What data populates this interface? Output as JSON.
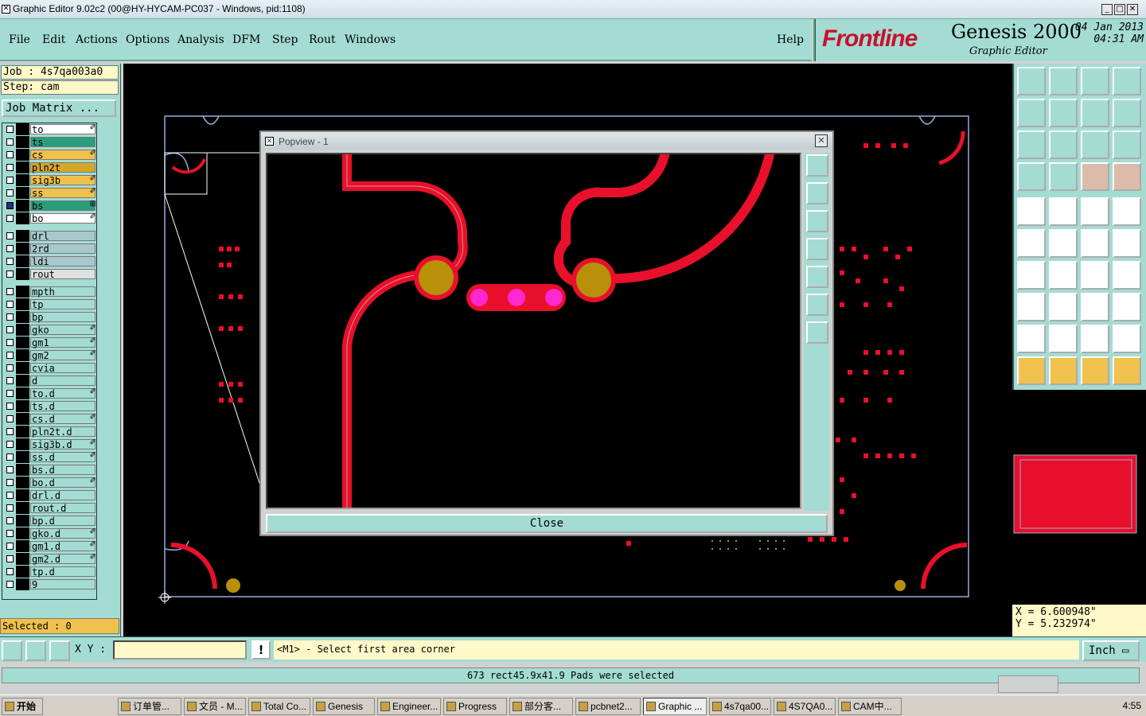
{
  "window": {
    "title": "Graphic Editor 9.02c2 (00@HY-HYCAM-PC037 - Windows, pid:1108)",
    "min": "_",
    "max": "□",
    "close": "✕"
  },
  "menu": {
    "file": "File",
    "edit": "Edit",
    "actions": "Actions",
    "options": "Options",
    "analysis": "Analysis",
    "dfm": "DFM",
    "step": "Step",
    "rout": "Rout",
    "windows": "Windows",
    "help": "Help"
  },
  "brand": {
    "logo": "Frontline",
    "product": "Genesis 2000",
    "subtitle": "Graphic Editor",
    "date": "04 Jan 2013",
    "time": "04:31 AM"
  },
  "job": {
    "job_line": "Job : 4s7qa003a0",
    "step_line": "Step: cam",
    "matrix_button": "Job Matrix ..."
  },
  "layers": [
    {
      "name": "to",
      "color": "#ffffff",
      "sw": "",
      "edit": "✐"
    },
    {
      "name": "ts",
      "color": "#2a9d7a",
      "sw": "",
      "edit": ""
    },
    {
      "name": "cs",
      "color": "#f0c14c",
      "sw": "",
      "edit": "✐"
    },
    {
      "name": "pln2t",
      "color": "#d4a72c",
      "sw": "",
      "edit": ""
    },
    {
      "name": "sig3b",
      "color": "#f0c14c",
      "sw": "",
      "edit": "✐"
    },
    {
      "name": "ss",
      "color": "#f0c14c",
      "sw": "",
      "edit": "✐"
    },
    {
      "name": "bs",
      "color": "#2a9d7a",
      "sw": "#e8102a",
      "edit": "⊞",
      "active": true
    },
    {
      "name": "bo",
      "color": "#ffffff",
      "sw": "",
      "edit": "✐"
    },
    {
      "name": "drl",
      "color": "#a8c8cc",
      "sw": "#3a9a2a",
      "edit": ""
    },
    {
      "name": "2rd",
      "color": "#a8c8cc",
      "sw": "#2040e0",
      "edit": ""
    },
    {
      "name": "ldi",
      "color": "#a8c8cc",
      "sw": "",
      "edit": ""
    },
    {
      "name": "rout",
      "color": "#e0e0e0",
      "sw": "",
      "edit": ""
    },
    {
      "name": "mpth",
      "color": "#a4dcd3",
      "sw": "",
      "edit": ""
    },
    {
      "name": "tp",
      "color": "#a4dcd3",
      "sw": "",
      "edit": ""
    },
    {
      "name": "bp",
      "color": "#a4dcd3",
      "sw": "",
      "edit": ""
    },
    {
      "name": "gko",
      "color": "#a4dcd3",
      "sw": "",
      "edit": "✐"
    },
    {
      "name": "gm1",
      "color": "#a4dcd3",
      "sw": "",
      "edit": "✐"
    },
    {
      "name": "gm2",
      "color": "#a4dcd3",
      "sw": "",
      "edit": "✐"
    },
    {
      "name": "cvia",
      "color": "#a4dcd3",
      "sw": "",
      "edit": ""
    },
    {
      "name": "d",
      "color": "#a4dcd3",
      "sw": "",
      "edit": ""
    },
    {
      "name": "to.d",
      "color": "#a4dcd3",
      "sw": "",
      "edit": "✐"
    },
    {
      "name": "ts.d",
      "color": "#a4dcd3",
      "sw": "",
      "edit": ""
    },
    {
      "name": "cs.d",
      "color": "#a4dcd3",
      "sw": "",
      "edit": "✐"
    },
    {
      "name": "pln2t.d",
      "color": "#a4dcd3",
      "sw": "",
      "edit": ""
    },
    {
      "name": "sig3b.d",
      "color": "#a4dcd3",
      "sw": "",
      "edit": "✐"
    },
    {
      "name": "ss.d",
      "color": "#a4dcd3",
      "sw": "",
      "edit": "✐"
    },
    {
      "name": "bs.d",
      "color": "#a4dcd3",
      "sw": "",
      "edit": ""
    },
    {
      "name": "bo.d",
      "color": "#a4dcd3",
      "sw": "",
      "edit": "✐"
    },
    {
      "name": "drl.d",
      "color": "#a4dcd3",
      "sw": "",
      "edit": ""
    },
    {
      "name": "rout.d",
      "color": "#a4dcd3",
      "sw": "",
      "edit": ""
    },
    {
      "name": "bp.d",
      "color": "#a4dcd3",
      "sw": "",
      "edit": ""
    },
    {
      "name": "gko.d",
      "color": "#a4dcd3",
      "sw": "",
      "edit": "✐"
    },
    {
      "name": "gm1.d",
      "color": "#a4dcd3",
      "sw": "",
      "edit": "✐"
    },
    {
      "name": "gm2.d",
      "color": "#a4dcd3",
      "sw": "",
      "edit": "✐"
    },
    {
      "name": "tp.d",
      "color": "#a4dcd3",
      "sw": "",
      "edit": ""
    },
    {
      "name": "9",
      "color": "#a4dcd3",
      "sw": "",
      "edit": ""
    }
  ],
  "selected": "Selected : 0",
  "popview": {
    "title": "Popview - 1",
    "close_label": "Close"
  },
  "coords": {
    "x": "X =  6.600948\"",
    "y": "Y =  5.232974\""
  },
  "cmd": {
    "xy_label": "X Y :",
    "xy_value": "",
    "warn": "!",
    "message": "<M1> - Select first area corner",
    "units": "Inch"
  },
  "status": "673 rect45.9x41.9 Pads were selected",
  "taskbar": {
    "start": "开始",
    "tasks": [
      "订单管...",
      "文员 - M...",
      "Total Co...",
      "Genesis",
      "Engineer...",
      "Progress",
      "部分客...",
      "pcbnet2...",
      "Graphic ...",
      "4s7qa00...",
      "4S7QA0...",
      "CAM中..."
    ],
    "clock": "4:55"
  },
  "colors": {
    "panel": "#a4dcd3",
    "trace": "#e8102a",
    "pad": "#b8900a",
    "drill": "#ff28d0"
  }
}
